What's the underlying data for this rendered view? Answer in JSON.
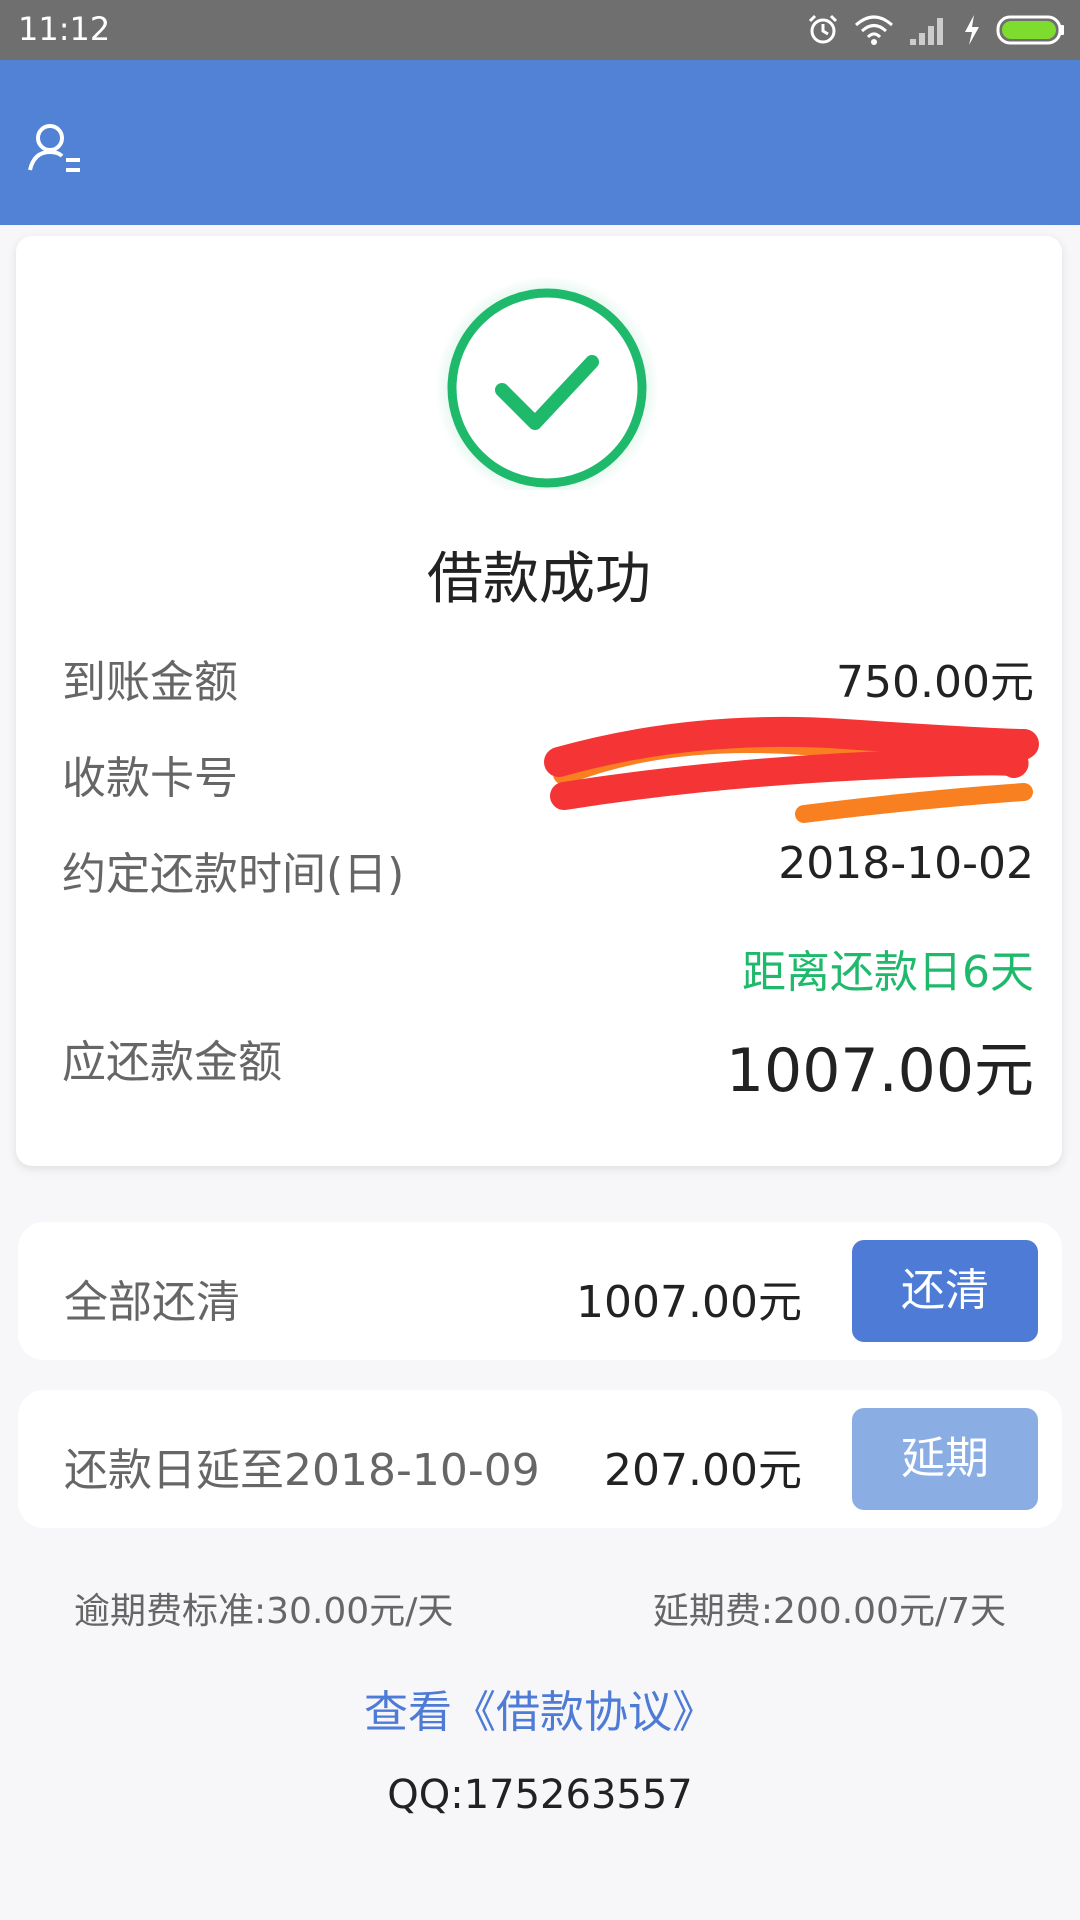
{
  "status_bar": {
    "time": "11:12"
  },
  "card": {
    "title": "借款成功",
    "rows": [
      {
        "label": "到账金额",
        "value": "750.00元"
      },
      {
        "label": "收款卡号",
        "value": ""
      },
      {
        "label": "约定还款时间(日)",
        "value": "2018-10-02"
      }
    ],
    "countdown": "距离还款日6天",
    "total_label": "应还款金额",
    "total_value": "1007.00元"
  },
  "options": [
    {
      "label": "全部还清",
      "amount": "1007.00元",
      "button": "还清"
    },
    {
      "label": "还款日延至2018-10-09",
      "amount": "207.00元",
      "button": "延期"
    }
  ],
  "fees": {
    "overdue": "逾期费标准:30.00元/天",
    "extension": "延期费:200.00元/7天"
  },
  "agreement_link": "查看《借款协议》",
  "contact": "QQ:175263557",
  "colors": {
    "primary": "#5282d6",
    "success": "#1fb96c",
    "button_disabled": "#8aaee3"
  }
}
